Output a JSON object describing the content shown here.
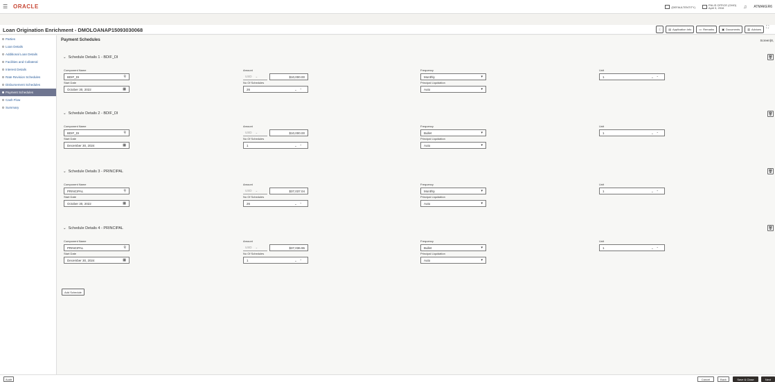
{
  "app": {
    "logo": "ORACLE",
    "entity": "(DEFAULTENTITY)",
    "office": "FNLIS OFFICE (CMO)",
    "date": "April 3, 2016",
    "user": "ATMAKER6"
  },
  "header": {
    "title": "Loan Origination Enrichment - DMOLOANAP15093030068",
    "buttons": {
      "application_info": "Application Info",
      "remarks": "Remarks",
      "documents": "Documents",
      "advices": "Advices"
    }
  },
  "sidebar": {
    "items": [
      {
        "label": "Parties"
      },
      {
        "label": "Loan Details"
      },
      {
        "label": "Additional Loan Details"
      },
      {
        "label": "Facilities and Collateral"
      },
      {
        "label": "Interest Details"
      },
      {
        "label": "Rate Revision Schedules"
      },
      {
        "label": "Disbursement Schedules"
      },
      {
        "label": "Payment Schedules"
      },
      {
        "label": "Cash Flow"
      },
      {
        "label": "Summary"
      }
    ]
  },
  "main": {
    "section_title": "Payment Schedules",
    "screen_label": "Screen(8,",
    "labels": {
      "component_name": "Component Name",
      "amount": "Amount",
      "frequency": "Frequency",
      "unit": "Unit",
      "start_date": "Start Date",
      "no_of_schedules": "No Of Schedules",
      "principal_liquidation": "Principal Liquidation"
    },
    "schedules": [
      {
        "title": "Schedule Details 1 - BDIF_DI",
        "component": "BDIF_DI",
        "currency": "USD",
        "amount": "$10,000.00",
        "frequency": "Monthly",
        "unit": "1",
        "start_date": "October 30, 2022",
        "no_of_schedules": "26",
        "principal_liquidation": "Auto"
      },
      {
        "title": "Schedule Details 2 - BDIF_DI",
        "component": "BDIF_DI",
        "currency": "USD",
        "amount": "$10,000.00",
        "frequency": "Bullet",
        "unit": "1",
        "start_date": "December 30, 2024",
        "no_of_schedules": "1",
        "principal_liquidation": "Auto"
      },
      {
        "title": "Schedule Details 3 - PRINCIPAL",
        "component": "PRINCIPAL",
        "currency": "USD",
        "amount": "$37,037.04",
        "frequency": "Monthly",
        "unit": "1",
        "start_date": "October 30, 2022",
        "no_of_schedules": "26",
        "principal_liquidation": "Auto"
      },
      {
        "title": "Schedule Details 4 - PRINCIPAL",
        "component": "PRINCIPAL",
        "currency": "USD",
        "amount": "$37,036.96",
        "frequency": "Bullet",
        "unit": "1",
        "start_date": "December 30, 2024",
        "no_of_schedules": "1",
        "principal_liquidation": "Auto"
      }
    ],
    "add_schedule": "Add Schedule"
  },
  "footer": {
    "audit": "Audit",
    "cancel": "Cancel",
    "back": "Back",
    "save_close": "Save & Close",
    "next": "Next"
  }
}
